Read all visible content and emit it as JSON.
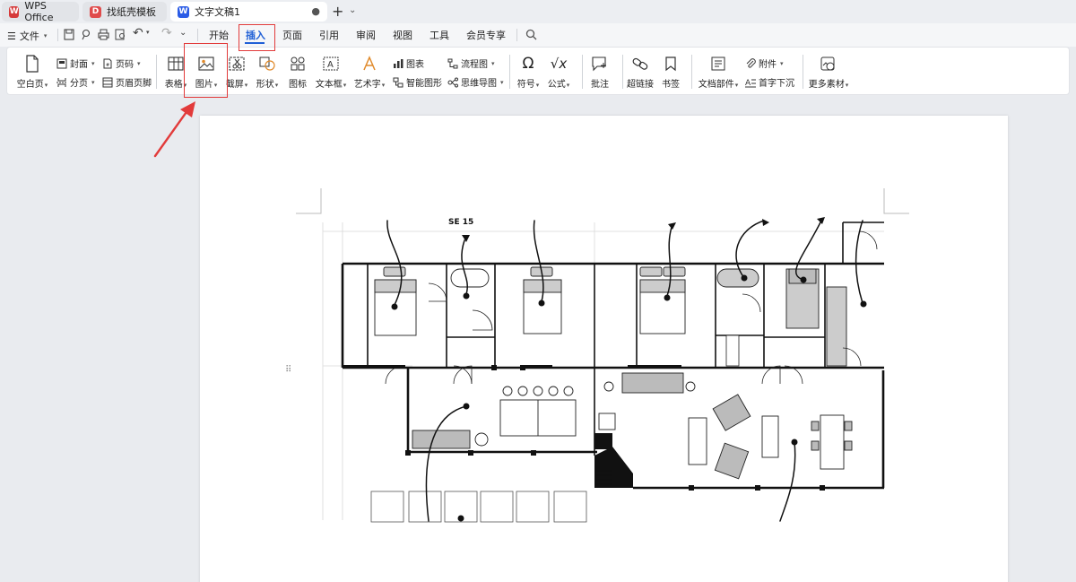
{
  "tabs": [
    {
      "label": "WPS Office",
      "logo": "W",
      "logo_color": "#d63b3b"
    },
    {
      "label": "找纸壳模板",
      "logo": "D",
      "logo_color": "#e04b4b"
    },
    {
      "label": "文字文稿1",
      "logo": "W",
      "logo_color": "#2b5ce6",
      "close": "●"
    }
  ],
  "file_menu": {
    "label": "文件"
  },
  "menu_tabs": [
    "开始",
    "插入",
    "页面",
    "引用",
    "审阅",
    "视图",
    "工具",
    "会员专享"
  ],
  "active_menu_tab": "插入",
  "ribbon": {
    "blank_page": "空白页",
    "cover": "封面",
    "page_break": "分页",
    "page_number": "页码",
    "header_footer": "页眉页脚",
    "table": "表格",
    "picture": "图片",
    "screenshot": "截屏",
    "shape": "形状",
    "icon": "图标",
    "text_box": "文本框",
    "word_art": "艺术字",
    "chart": "图表",
    "smart_art": "智能图形",
    "flowchart": "流程图",
    "mind_map": "思维导图",
    "symbol": "符号",
    "formula": "公式",
    "comment": "批注",
    "hyperlink": "超链接",
    "bookmark": "书签",
    "doc_parts": "文档部件",
    "attachment": "附件",
    "drop_cap": "首字下沉",
    "more_materials": "更多素材"
  },
  "floorplan": {
    "room_label": "SE 15"
  },
  "colors": {
    "accent": "#1f5fd6",
    "highlight": "#e23b3b"
  }
}
